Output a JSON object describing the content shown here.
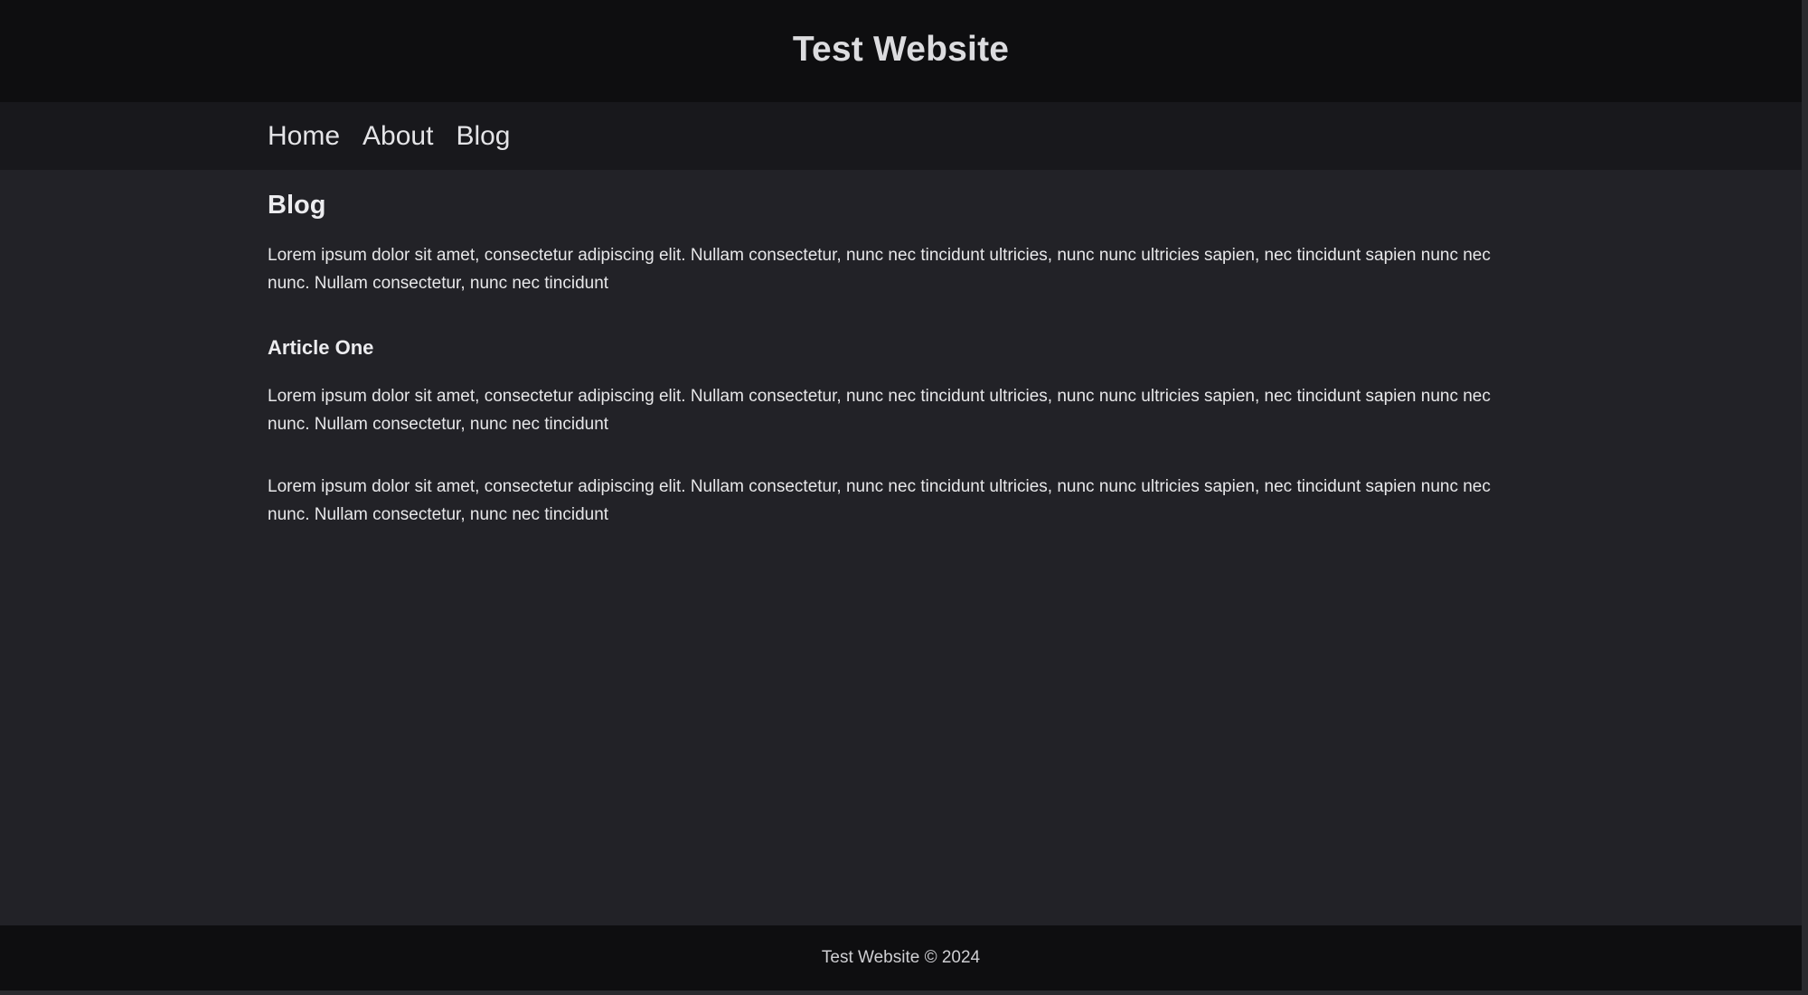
{
  "header": {
    "title": "Test Website"
  },
  "nav": {
    "items": [
      {
        "label": "Home"
      },
      {
        "label": "About"
      },
      {
        "label": "Blog"
      }
    ]
  },
  "main": {
    "heading": "Blog",
    "intro": "Lorem ipsum dolor sit amet, consectetur adipiscing elit. Nullam consectetur, nunc nec tincidunt ultricies, nunc nunc ultricies sapien, nec tincidunt sapien nunc nec nunc. Nullam consectetur, nunc nec tincidunt",
    "articles": [
      {
        "title": "Article One",
        "paragraphs": [
          "Lorem ipsum dolor sit amet, consectetur adipiscing elit. Nullam consectetur, nunc nec tincidunt ultricies, nunc nunc ultricies sapien, nec tincidunt sapien nunc nec nunc. Nullam consectetur, nunc nec tincidunt",
          "Lorem ipsum dolor sit amet, consectetur adipiscing elit. Nullam consectetur, nunc nec tincidunt ultricies, nunc nunc ultricies sapien, nec tincidunt sapien nunc nec nunc. Nullam consectetur, nunc nec tincidunt"
        ]
      }
    ]
  },
  "footer": {
    "text": "Test Website © 2024"
  },
  "colors": {
    "header_bg": "#0e0e10",
    "nav_bg": "#18181c",
    "content_bg": "#222227",
    "text": "#ececef"
  }
}
